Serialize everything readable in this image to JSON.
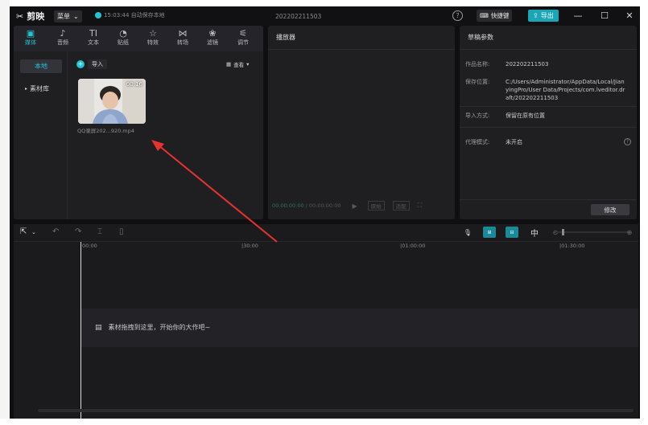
{
  "titlebar": {
    "app_name": "剪映",
    "menu_label": "菜单",
    "save_status": "15:03:44 自动保存本地",
    "project_title": "202202211503",
    "shortcut_label": "快捷键",
    "export_label": "导出",
    "help_glyph": "?",
    "minimize_glyph": "—",
    "maximize_glyph": "☐",
    "close_glyph": "✕"
  },
  "media_toolbar": {
    "items": [
      {
        "label": "媒体",
        "icon": "media-icon",
        "glyph": "▣",
        "active": true
      },
      {
        "label": "音频",
        "icon": "audio-icon",
        "glyph": "♪",
        "active": false
      },
      {
        "label": "文本",
        "icon": "text-icon",
        "glyph": "TI",
        "active": false
      },
      {
        "label": "贴纸",
        "icon": "sticker-icon",
        "glyph": "◔",
        "active": false
      },
      {
        "label": "特效",
        "icon": "effects-icon",
        "glyph": "☆",
        "active": false
      },
      {
        "label": "转场",
        "icon": "transition-icon",
        "glyph": "⋈",
        "active": false
      },
      {
        "label": "滤镜",
        "icon": "filter-icon",
        "glyph": "❀",
        "active": false
      },
      {
        "label": "调节",
        "icon": "adjust-icon",
        "glyph": "⚟",
        "active": false
      }
    ]
  },
  "media_sidebar": {
    "local": "本地",
    "library": "素材库"
  },
  "media_main": {
    "import_label": "导入",
    "view_label": "查看",
    "clip": {
      "duration": "00:16",
      "name": "QQ录屏202...920.mp4"
    }
  },
  "player": {
    "title": "播放器",
    "current_time": "00:00:00:00",
    "total_time": "00:00:00:00",
    "ratio_label": "原始",
    "ratio_label2": "适配"
  },
  "draft": {
    "title": "草稿参数",
    "rows": [
      {
        "key": "作品名称:",
        "value": "202202211503"
      },
      {
        "key": "保存位置:",
        "value": "C:/Users/Administrator/AppData/Local/JianyingPro/User Data/Projects/com.lveditor.draft/202202211503"
      },
      {
        "key": "导入方式:",
        "value": "保留在原有位置"
      },
      {
        "key": "代理模式:",
        "value": "未开启"
      }
    ],
    "modify_label": "修改"
  },
  "timeline": {
    "ruler_labels": [
      "00:00",
      "|30:00",
      "|01:00:00",
      "|01:30:00"
    ],
    "drop_hint": "素材拖拽到这里，开始你的大作吧~"
  },
  "colors": {
    "accent": "#22c4d6",
    "export_bg": "#1aa6b7",
    "annotation_arrow": "#e8322e"
  }
}
